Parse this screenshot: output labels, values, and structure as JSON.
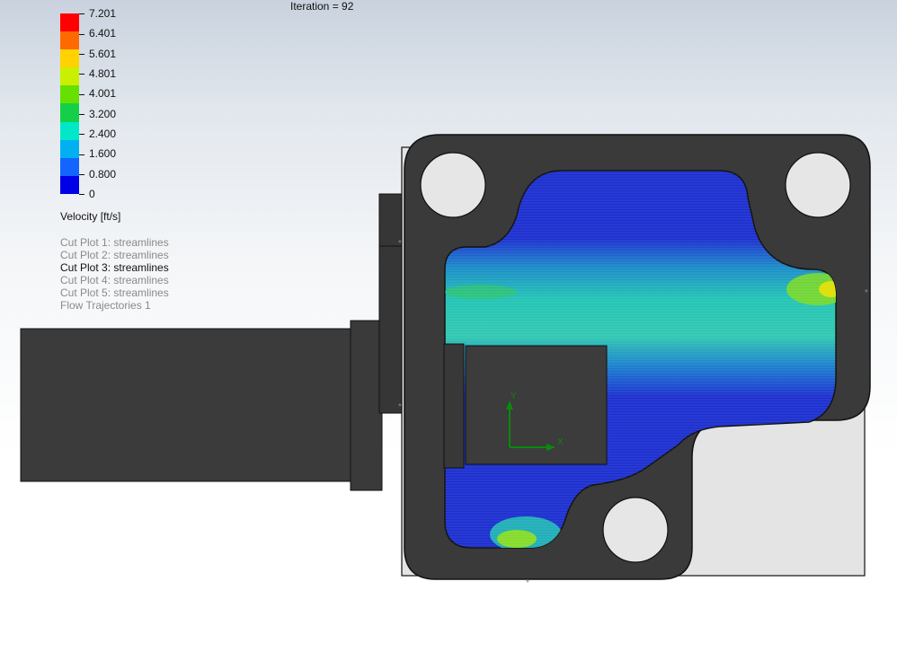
{
  "iteration_label": "Iteration = 92",
  "legend": {
    "title": "Velocity [ft/s]",
    "ticks": [
      "7.201",
      "6.401",
      "5.601",
      "4.801",
      "4.001",
      "3.200",
      "2.400",
      "1.600",
      "0.800",
      "0"
    ],
    "colors": [
      "#ff0000",
      "#ff6a00",
      "#ffd200",
      "#c8f000",
      "#66e000",
      "#14d048",
      "#00e8c8",
      "#00b0f0",
      "#1464ff",
      "#0000e6"
    ]
  },
  "plots": [
    {
      "label": "Cut Plot 1: streamlines",
      "active": false
    },
    {
      "label": "Cut Plot 2: streamlines",
      "active": false
    },
    {
      "label": "Cut Plot 3: streamlines",
      "active": true
    },
    {
      "label": "Cut Plot 4: streamlines",
      "active": false
    },
    {
      "label": "Cut Plot 5: streamlines",
      "active": false
    },
    {
      "label": "Flow Trajectories 1",
      "active": false
    }
  ],
  "triad": {
    "y_label": "Y",
    "x_label": "X"
  }
}
